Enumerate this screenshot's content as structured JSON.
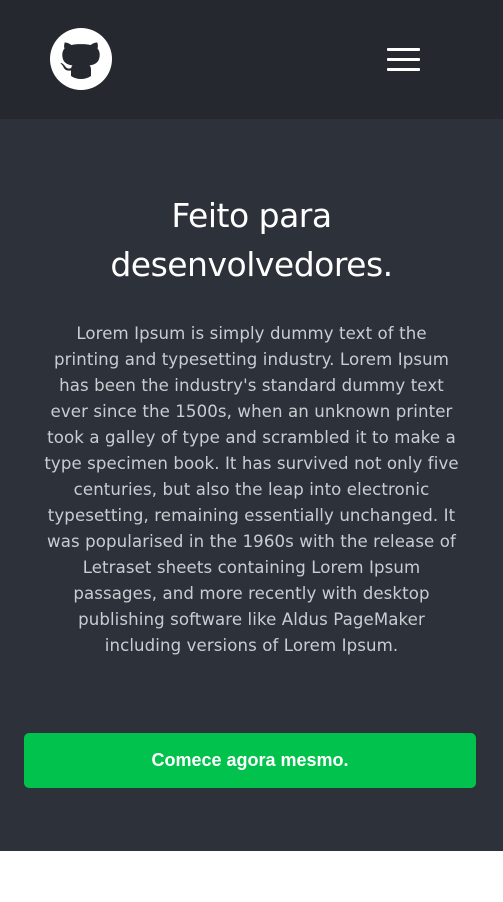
{
  "header": {
    "logo_icon": "github-octocat-icon",
    "menu_icon": "hamburger-menu-icon"
  },
  "hero": {
    "title_line1": "Feito para",
    "title_line2": "desenvolvedores.",
    "description": "Lorem Ipsum is simply dummy text of the printing and typesetting industry. Lorem Ipsum has been the industry's standard dummy text ever since the 1500s, when an unknown printer took a galley of type and scrambled it to make a type specimen book. It has survived not only five centuries, but also the leap into electronic typesetting, remaining essentially unchanged. It was popularised in the 1960s with the release of Letraset sheets containing Lorem Ipsum passages, and more recently with desktop publishing software like Aldus PageMaker including versions of Lorem Ipsum.",
    "cta_label": "Comece agora mesmo."
  },
  "colors": {
    "header_bg": "#25282e",
    "hero_bg": "#2d3139",
    "cta_bg": "#00c24c",
    "text_primary": "#ffffff",
    "text_secondary": "#c9ccd1"
  }
}
